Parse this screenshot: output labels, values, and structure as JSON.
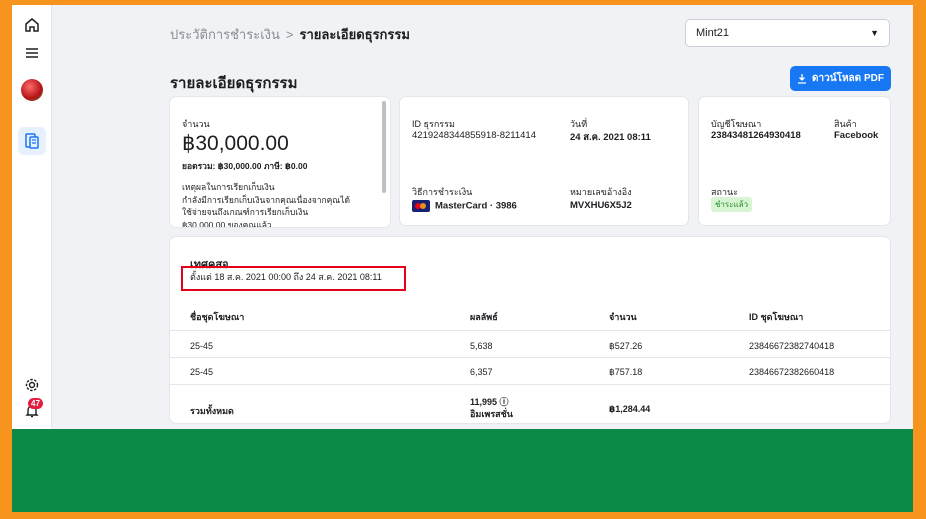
{
  "breadcrumb": {
    "parent": "ประวัติการชำระเงิน",
    "separator": ">",
    "current": "รายละเอียดธุรกรรม"
  },
  "account_select": {
    "value": "Mint21"
  },
  "page_title": "รายละเอียดธุรกรรม",
  "download_button": "ดาวน์โหลด PDF",
  "amount_card": {
    "label": "จำนวน",
    "amount": "฿30,000.00",
    "subtotal": "ยอดรวม: ฿30,000.00  ภาษี: ฿0.00",
    "reason_title": "เหตุผลในการเรียกเก็บเงิน",
    "reason_line1": "กำลังมีการเรียกเก็บเงินจากคุณเนื่องจากคุณได้",
    "reason_line2": "ใช้จ่ายจนถึงเกณฑ์การเรียกเก็บเงิน",
    "reason_line3": "฿30,000.00 ของคุณแล้ว"
  },
  "transaction_card": {
    "id_label": "ID ธุรกรรม",
    "id_value": "4219248344855918-8211414",
    "date_label": "วันที่",
    "date_value": "24 ส.ค. 2021 08:11",
    "method_label": "วิธีการชำระเงิน",
    "method_value": "MasterCard · 3986",
    "ref_label": "หมายเลขอ้างอิง",
    "ref_value": "MVXHU6X5J2"
  },
  "account_card": {
    "account_label": "บัญชีโฆษณา",
    "account_value": "23843481264930418",
    "product_label": "สินค้า",
    "product_value": "Facebook",
    "status_label": "สถานะ",
    "status_value": "ชำระแล้ว"
  },
  "summary": {
    "title": "เทศคสจ",
    "date_range": "ตั้งแต่ 18 ส.ค. 2021 00:00 ถึง 24 ส.ค. 2021 08:11",
    "columns": [
      "ชื่อชุดโฆษณา",
      "ผลลัพธ์",
      "จำนวน",
      "ID ชุดโฆษณา"
    ],
    "rows": [
      [
        "25-45",
        "5,638",
        "฿527.26",
        "23846672382740418"
      ],
      [
        "25-45",
        "6,357",
        "฿757.18",
        "23846672382660418"
      ]
    ],
    "total": {
      "label": "รวมทั้งหมด",
      "results": "11,995 ⓘ",
      "results_sub": "อิมเพรสชั่น",
      "amount": "฿1,284.44"
    }
  },
  "notification_count": "47",
  "colors": {
    "accent": "#1877f2",
    "highlight": "#e5001a",
    "frame": "#f7941d",
    "bottom_bar": "#0b8a47"
  }
}
